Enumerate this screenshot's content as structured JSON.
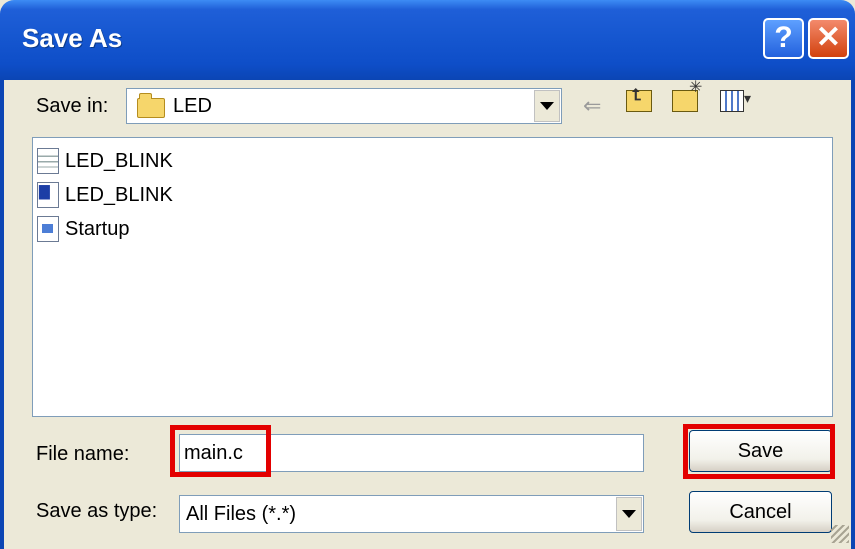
{
  "window": {
    "title": "Save As"
  },
  "titlebar": {
    "help_label": "?",
    "close_label": "✕"
  },
  "save_in": {
    "label": "Save in:",
    "value": "LED"
  },
  "toolbar": {
    "back_icon": "back-arrow-icon",
    "up_icon": "up-folder-icon",
    "new_folder_icon": "new-folder-icon",
    "views_icon": "views-menu-icon"
  },
  "files": [
    {
      "name": "LED_BLINK",
      "icon": "text-document-icon"
    },
    {
      "name": "LED_BLINK",
      "icon": "uvision-project-icon"
    },
    {
      "name": "Startup",
      "icon": "asm-source-icon"
    }
  ],
  "filename": {
    "label": "File name:",
    "value": "main.c"
  },
  "save_type": {
    "label": "Save as type:",
    "value": "All Files (*.*)"
  },
  "buttons": {
    "save": "Save",
    "cancel": "Cancel"
  },
  "colors": {
    "titlebar": "#0b45b4",
    "highlight": "#e30000",
    "dialog_bg": "#ece9d8"
  }
}
